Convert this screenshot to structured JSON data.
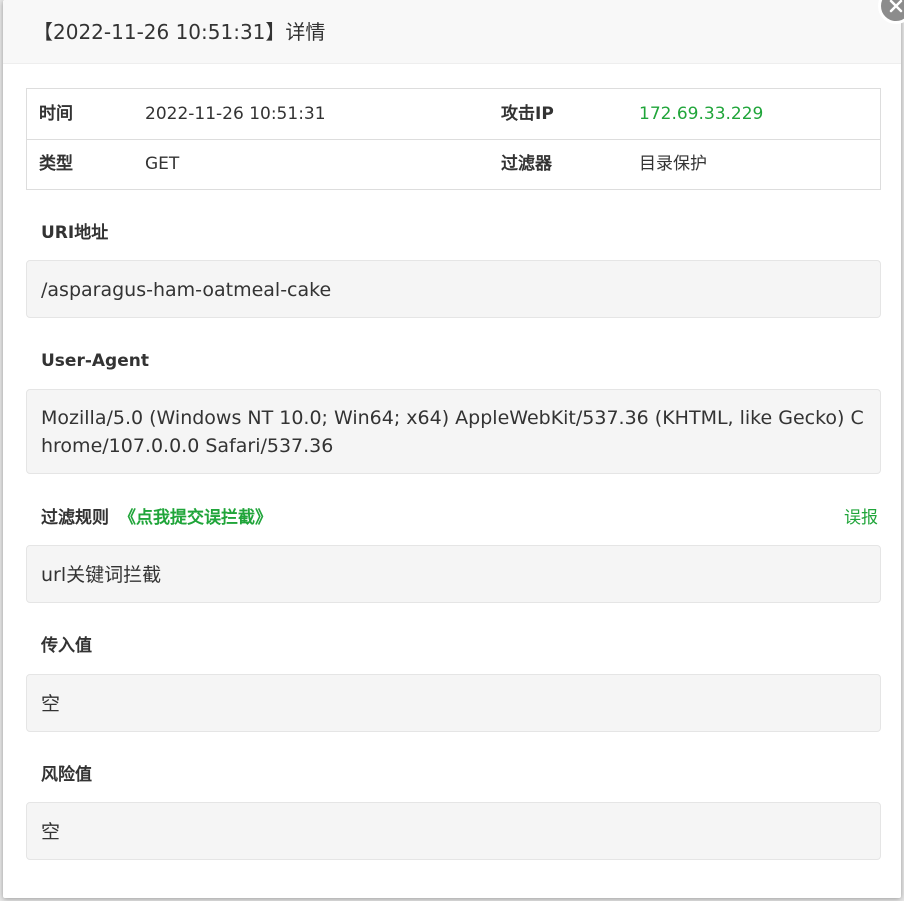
{
  "header": {
    "title": "【2022-11-26 10:51:31】详情"
  },
  "info": {
    "time_label": "时间",
    "time_value": "2022-11-26 10:51:31",
    "ip_label": "攻击IP",
    "ip_value": "172.69.33.229",
    "type_label": "类型",
    "type_value": "GET",
    "filter_label": "过滤器",
    "filter_value": "目录保护"
  },
  "uri": {
    "label": "URI地址",
    "value": "/asparagus-ham-oatmeal-cake"
  },
  "user_agent": {
    "label": "User-Agent",
    "value": "Mozilla/5.0 (Windows NT 10.0; Win64; x64) AppleWebKit/537.36 (KHTML, like Gecko) Chrome/107.0.0.0 Safari/537.36"
  },
  "filter_rule": {
    "label": "过滤规则",
    "submit_link": "《点我提交误拦截》",
    "report_link": "误报",
    "value": "url关键词拦截"
  },
  "input_value": {
    "label": "传入值",
    "value": "空"
  },
  "risk_value": {
    "label": "风险值",
    "value": "空"
  },
  "colors": {
    "accent_green": "#20a53a",
    "box_bg": "#f5f5f5"
  },
  "icons": {
    "close": "close-icon"
  }
}
